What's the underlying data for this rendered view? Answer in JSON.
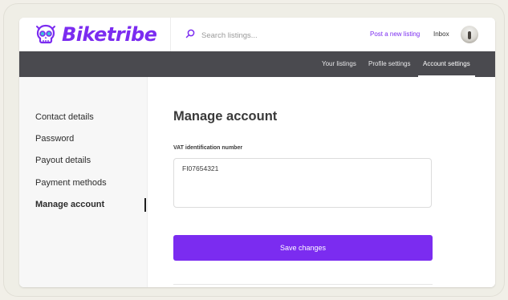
{
  "app": {
    "name": "Biketribe",
    "brand_color": "#7b2cf0"
  },
  "header": {
    "search": {
      "placeholder": "Search listings...",
      "icon": "search-icon"
    },
    "post_link": "Post a new listing",
    "inbox_link": "Inbox"
  },
  "subnav": {
    "tabs": [
      {
        "label": "Your listings"
      },
      {
        "label": "Profile settings"
      },
      {
        "label": "Account settings",
        "active": true
      }
    ]
  },
  "sidebar": {
    "items": [
      {
        "label": "Contact details"
      },
      {
        "label": "Password"
      },
      {
        "label": "Payout details"
      },
      {
        "label": "Payment methods"
      },
      {
        "label": "Manage account",
        "active": true
      }
    ]
  },
  "main": {
    "title": "Manage account",
    "vat_label": "VAT identification number",
    "vat_value": "FI07654321",
    "save_label": "Save changes"
  }
}
